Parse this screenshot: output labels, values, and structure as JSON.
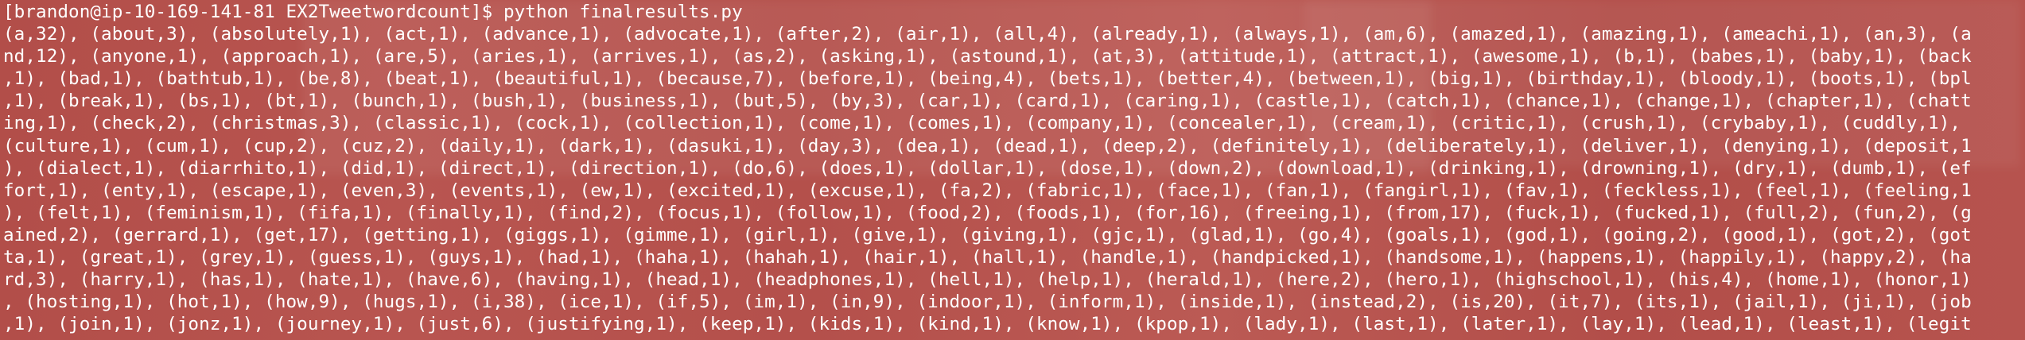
{
  "terminal": {
    "prompt": "[brandon@ip-10-169-141-81 EX2Tweetwordcount]$ python finalresults.py",
    "output_lines": [
      "(a,32), (about,3), (absolutely,1), (act,1), (advance,1), (advocate,1), (after,2), (air,1), (all,4), (already,1), (always,1), (am,6), (amazed,1), (amazing,1), (ameachi,1), (an,3), (a",
      "nd,12), (anyone,1), (approach,1), (are,5), (aries,1), (arrives,1), (as,2), (asking,1), (astound,1), (at,3), (attitude,1), (attract,1), (awesome,1), (b,1), (babes,1), (baby,1), (back",
      ",1), (bad,1), (bathtub,1), (be,8), (beat,1), (beautiful,1), (because,7), (before,1), (being,4), (bets,1), (better,4), (between,1), (big,1), (birthday,1), (bloody,1), (boots,1), (bpl",
      ",1), (break,1), (bs,1), (bt,1), (bunch,1), (bush,1), (business,1), (but,5), (by,3), (car,1), (card,1), (caring,1), (castle,1), (catch,1), (chance,1), (change,1), (chapter,1), (chatt",
      "ing,1), (check,2), (christmas,3), (classic,1), (cock,1), (collection,1), (come,1), (comes,1), (company,1), (concealer,1), (cream,1), (critic,1), (crush,1), (crybaby,1), (cuddly,1),",
      "(culture,1), (cum,1), (cup,2), (cuz,2), (daily,1), (dark,1), (dasuki,1), (day,3), (dea,1), (dead,1), (deep,2), (definitely,1), (deliberately,1), (deliver,1), (denying,1), (deposit,1",
      "), (dialect,1), (diarrhito,1), (did,1), (direct,1), (direction,1), (do,6), (does,1), (dollar,1), (dose,1), (down,2), (download,1), (drinking,1), (drowning,1), (dry,1), (dumb,1), (ef",
      "fort,1), (enty,1), (escape,1), (even,3), (events,1), (ew,1), (excited,1), (excuse,1), (fa,2), (fabric,1), (face,1), (fan,1), (fangirl,1), (fav,1), (feckless,1), (feel,1), (feeling,1",
      "), (felt,1), (feminism,1), (fifa,1), (finally,1), (find,2), (focus,1), (follow,1), (food,2), (foods,1), (for,16), (freeing,1), (from,17), (fuck,1), (fucked,1), (full,2), (fun,2), (g",
      "ained,2), (gerrard,1), (get,17), (getting,1), (giggs,1), (gimme,1), (girl,1), (give,1), (giving,1), (gjc,1), (glad,1), (go,4), (goals,1), (god,1), (going,2), (good,1), (got,2), (got",
      "ta,1), (great,1), (grey,1), (guess,1), (guys,1), (had,1), (haha,1), (hahah,1), (hair,1), (hall,1), (handle,1), (handpicked,1), (handsome,1), (happens,1), (happily,1), (happy,2), (ha",
      "rd,3), (harry,1), (has,1), (hate,1), (have,6), (having,1), (head,1), (headphones,1), (hell,1), (help,1), (herald,1), (here,2), (hero,1), (highschool,1), (his,4), (home,1), (honor,1)",
      ", (hosting,1), (hot,1), (how,9), (hugs,1), (i,38), (ice,1), (if,5), (im,1), (in,9), (indoor,1), (inform,1), (inside,1), (instead,2), (is,20), (it,7), (its,1), (jail,1), (ji,1), (job",
      ",1), (join,1), (jonz,1), (journey,1), (just,6), (justifying,1), (keep,1), (kids,1), (kind,1), (know,1), (kpop,1), (lady,1), (last,1), (later,1), (lay,1), (lead,1), (least,1), (legit"
    ]
  }
}
